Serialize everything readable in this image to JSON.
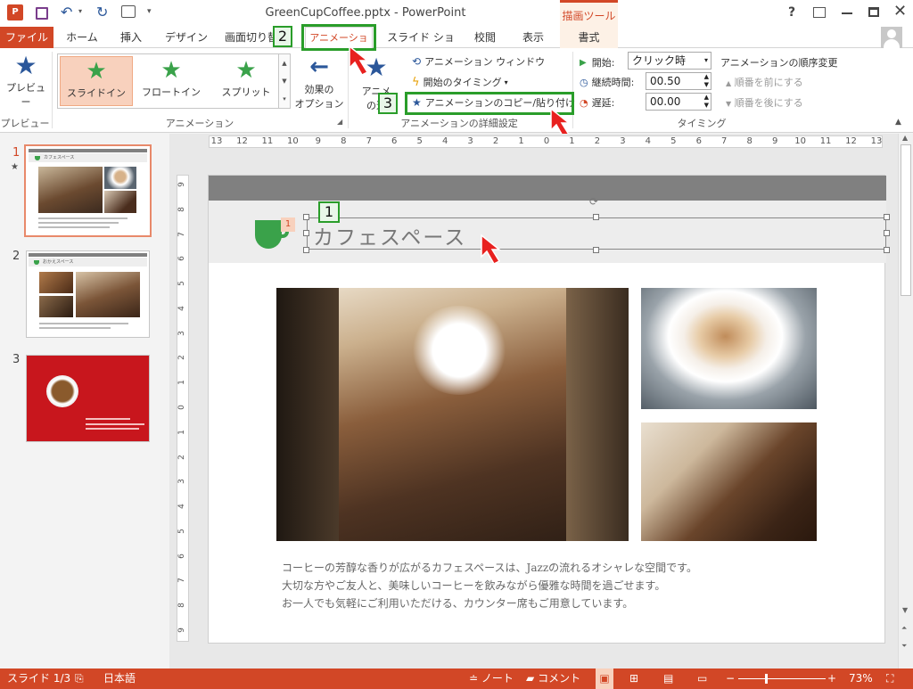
{
  "window": {
    "title": "GreenCupCoffee.pptx - PowerPoint",
    "help": "?"
  },
  "drawing_tools": {
    "label": "描画ツール",
    "tab": "書式"
  },
  "tabs": [
    "ファイル",
    "ホーム",
    "挿入",
    "デザイン",
    "画面切り替え",
    "アニメーション",
    "スライド ショー",
    "校閲",
    "表示"
  ],
  "ribbon": {
    "preview": {
      "label": "プレビュー",
      "group": "プレビュー"
    },
    "animation_gallery": {
      "items": [
        "スライドイン",
        "フロートイン",
        "スプリット"
      ],
      "group": "アニメーション"
    },
    "effect_options": {
      "line1": "効果の",
      "line2": "オプション"
    },
    "add_animation": {
      "line1": "アニメ",
      "line2": "の追"
    },
    "advanced": {
      "anim_window": "アニメーション ウィンドウ",
      "trigger": "開始のタイミング",
      "painter": "アニメーションのコピー/貼り付け",
      "group": "アニメーションの詳細設定"
    },
    "timing": {
      "start_label": "開始:",
      "start_value": "クリック時",
      "duration_label": "継続時間:",
      "duration_value": "00.50",
      "delay_label": "遅延:",
      "delay_value": "00.00",
      "group": "タイミング"
    },
    "reorder": {
      "title": "アニメーションの順序変更",
      "earlier": "順番を前にする",
      "later": "順番を後にする"
    }
  },
  "callouts": [
    "1",
    "2",
    "3"
  ],
  "slides": [
    {
      "num": "1",
      "title": "カフェスペース",
      "star": "★"
    },
    {
      "num": "2",
      "title": "おかえスペース"
    },
    {
      "num": "3",
      "title": ""
    }
  ],
  "slide": {
    "title": "カフェスペース",
    "anim_tag": "1",
    "body": [
      "コーヒーの芳醇な香りが広がるカフェスペースは、Jazzの流れるオシャレな空間です。",
      "大切な方やご友人と、美味しいコーヒーを飲みながら優雅な時間を過ごせます。",
      "お一人でも気軽にご利用いただける、カウンター席もご用意しています。"
    ]
  },
  "ruler": {
    "h": [
      "13",
      "12",
      "11",
      "10",
      "9",
      "8",
      "7",
      "6",
      "5",
      "4",
      "3",
      "2",
      "1",
      "0",
      "1",
      "2",
      "3",
      "4",
      "5",
      "6",
      "7",
      "8",
      "9",
      "10",
      "11",
      "12",
      "13"
    ],
    "v": [
      "9",
      "8",
      "7",
      "6",
      "5",
      "4",
      "3",
      "2",
      "1",
      "0",
      "1",
      "2",
      "3",
      "4",
      "5",
      "6",
      "7",
      "8",
      "9"
    ]
  },
  "status": {
    "slide": "スライド 1/3",
    "lang": "日本語",
    "notes": "ノート",
    "comments": "コメント",
    "zoom": "73%"
  },
  "colors": {
    "accent": "#d24726",
    "green": "#2a9d2a",
    "slide_header": "#808080",
    "cup_green": "#3aa24a"
  }
}
